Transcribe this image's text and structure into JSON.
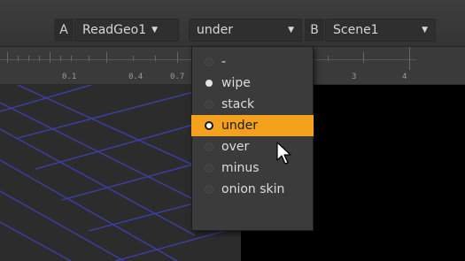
{
  "header": {
    "input_a_label": "A",
    "input_a_node": "ReadGeo1",
    "merge_mode": "under",
    "input_b_label": "B",
    "input_b_node": "Scene1"
  },
  "ruler": {
    "ticks": [
      "0.1",
      "0.4",
      "0.7",
      "3",
      "4"
    ]
  },
  "menu": {
    "items": [
      {
        "label": "-",
        "state": "normal"
      },
      {
        "label": "wipe",
        "state": "checked"
      },
      {
        "label": "stack",
        "state": "normal"
      },
      {
        "label": "under",
        "state": "highlighted"
      },
      {
        "label": "over",
        "state": "normal"
      },
      {
        "label": "minus",
        "state": "normal"
      },
      {
        "label": "onion skin",
        "state": "normal"
      }
    ]
  },
  "icons": {
    "dropdown": "chevron-down-icon",
    "cursor": "mouse-pointer-icon"
  },
  "colors": {
    "highlight": "#f4a21e",
    "grid_lines": "#3c3fa8"
  }
}
